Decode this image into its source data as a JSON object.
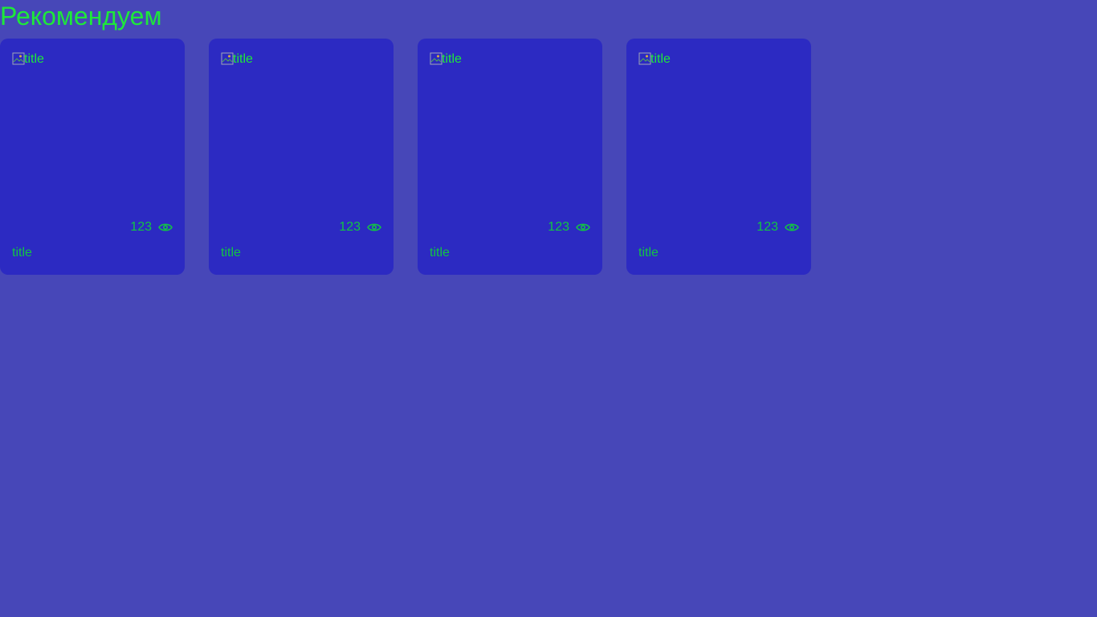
{
  "section": {
    "title": "Рекомендуем"
  },
  "cards": [
    {
      "image_alt": "title",
      "views": "123",
      "title": "title"
    },
    {
      "image_alt": "title",
      "views": "123",
      "title": "title"
    },
    {
      "image_alt": "title",
      "views": "123",
      "title": "title"
    },
    {
      "image_alt": "title",
      "views": "123",
      "title": "title"
    }
  ],
  "icons": {
    "views": "eye-icon",
    "broken_image": "broken-image-icon"
  },
  "colors": {
    "page_background": "#4747b8",
    "card_background": "#2c2ac2",
    "heading": "#1ee83a",
    "card_text": "#12c444"
  }
}
